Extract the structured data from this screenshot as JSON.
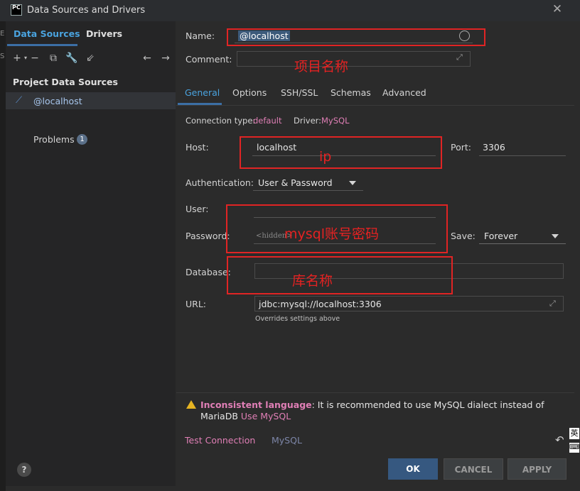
{
  "window": {
    "title": "Data Sources and Drivers",
    "app_icon_text": "PC"
  },
  "sidebar": {
    "tabs": [
      {
        "label": "Data Sources"
      },
      {
        "label": "Drivers"
      }
    ],
    "section_title": "Project Data Sources",
    "data_source": {
      "label": "@localhost"
    },
    "problems": {
      "label": "Problems",
      "count": "1"
    }
  },
  "form": {
    "name_label": "Name:",
    "name_value": "@localhost",
    "comment_label": "Comment:",
    "tabs": [
      "General",
      "Options",
      "SSH/SSL",
      "Schemas",
      "Advanced"
    ],
    "connection_type_label": "Connection type:",
    "connection_type_value": "default",
    "driver_label": "Driver:",
    "driver_value": "MySQL",
    "host_label": "Host:",
    "host_value": "localhost",
    "port_label": "Port:",
    "port_value": "3306",
    "auth_label": "Authentication:",
    "auth_value": "User & Password",
    "user_label": "User:",
    "password_label": "Password:",
    "password_placeholder": "<hidden>",
    "save_label": "Save:",
    "save_value": "Forever",
    "database_label": "Database:",
    "url_label": "URL:",
    "url_value": "jdbc:mysql://localhost:3306",
    "url_hint": "Overrides settings above"
  },
  "annotations": {
    "project_name": "项目名称",
    "ip": "ip",
    "credentials": "mysql账号密码",
    "db_name": "库名称"
  },
  "warning": {
    "title": "Inconsistent language",
    "text_1": ": It is recommended to use MySQL dialect instead of",
    "text_2": "MariaDB ",
    "link": "Use MySQL"
  },
  "footer": {
    "test_connection": "Test Connection",
    "driver_link": "MySQL",
    "ok": "OK",
    "cancel": "CANCEL",
    "apply": "APPLY",
    "help": "?"
  },
  "ime": {
    "lang": "英",
    "extra": "⌨"
  },
  "icons": [
    "add-icon",
    "remove-icon",
    "copy-icon",
    "wrench-icon",
    "import-icon",
    "back-icon",
    "forward-icon",
    "expand-icon",
    "undo-icon",
    "warning-icon",
    "database-icon"
  ]
}
